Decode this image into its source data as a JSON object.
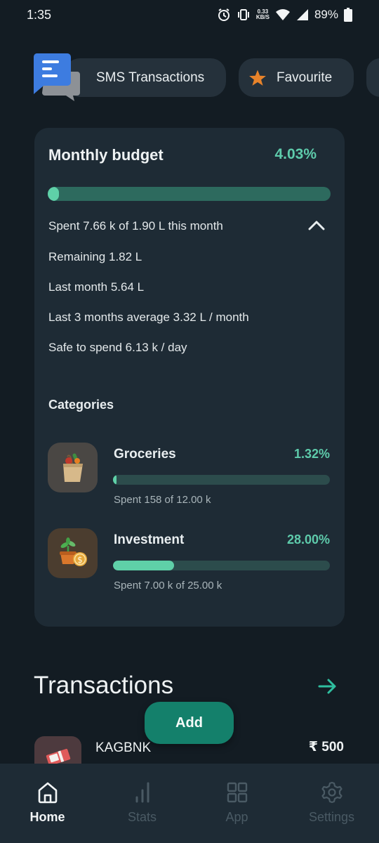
{
  "status_bar": {
    "time": "1:35",
    "net_speed_value": "0.33",
    "net_speed_unit": "KB/S",
    "battery": "89%"
  },
  "chips": {
    "sms_label": "SMS Transactions",
    "favourite_label": "Favourite"
  },
  "budget": {
    "title": "Monthly budget",
    "percent": "4.03%",
    "progress_fraction": 0.0403,
    "spent_line": "Spent 7.66 k of 1.90 L this month",
    "remaining_line": "Remaining 1.82 L",
    "last_month_line": "Last month 5.64 L",
    "average_line": "Last 3 months average 3.32 L / month",
    "safe_line": "Safe to spend 6.13 k / day"
  },
  "categories": {
    "heading": "Categories",
    "items": [
      {
        "name": "Groceries",
        "percent": "1.32%",
        "progress_fraction": 0.0132,
        "subtitle": "Spent 158 of 12.00 k",
        "icon": "grocery-bag-icon"
      },
      {
        "name": "Investment",
        "percent": "28.00%",
        "progress_fraction": 0.28,
        "subtitle": "Spent 7.00 k of 25.00 k",
        "icon": "plant-coin-icon"
      }
    ]
  },
  "transactions": {
    "title": "Transactions",
    "items": [
      {
        "name": "KAGBNK",
        "amount": "₹ 500",
        "icon": "cash-icon"
      }
    ]
  },
  "add_button": {
    "label": "Add"
  },
  "bottom_nav": {
    "items": [
      {
        "label": "Home",
        "icon": "home-icon",
        "active": true
      },
      {
        "label": "Stats",
        "icon": "stats-icon",
        "active": false
      },
      {
        "label": "App",
        "icon": "apps-grid-icon",
        "active": false
      },
      {
        "label": "Settings",
        "icon": "gear-icon",
        "active": false
      }
    ]
  },
  "colors": {
    "accent": "#5fd0a8",
    "track": "#2d6a5e",
    "card": "#1e2b35",
    "background": "#131c23",
    "add_button": "#14806b"
  }
}
